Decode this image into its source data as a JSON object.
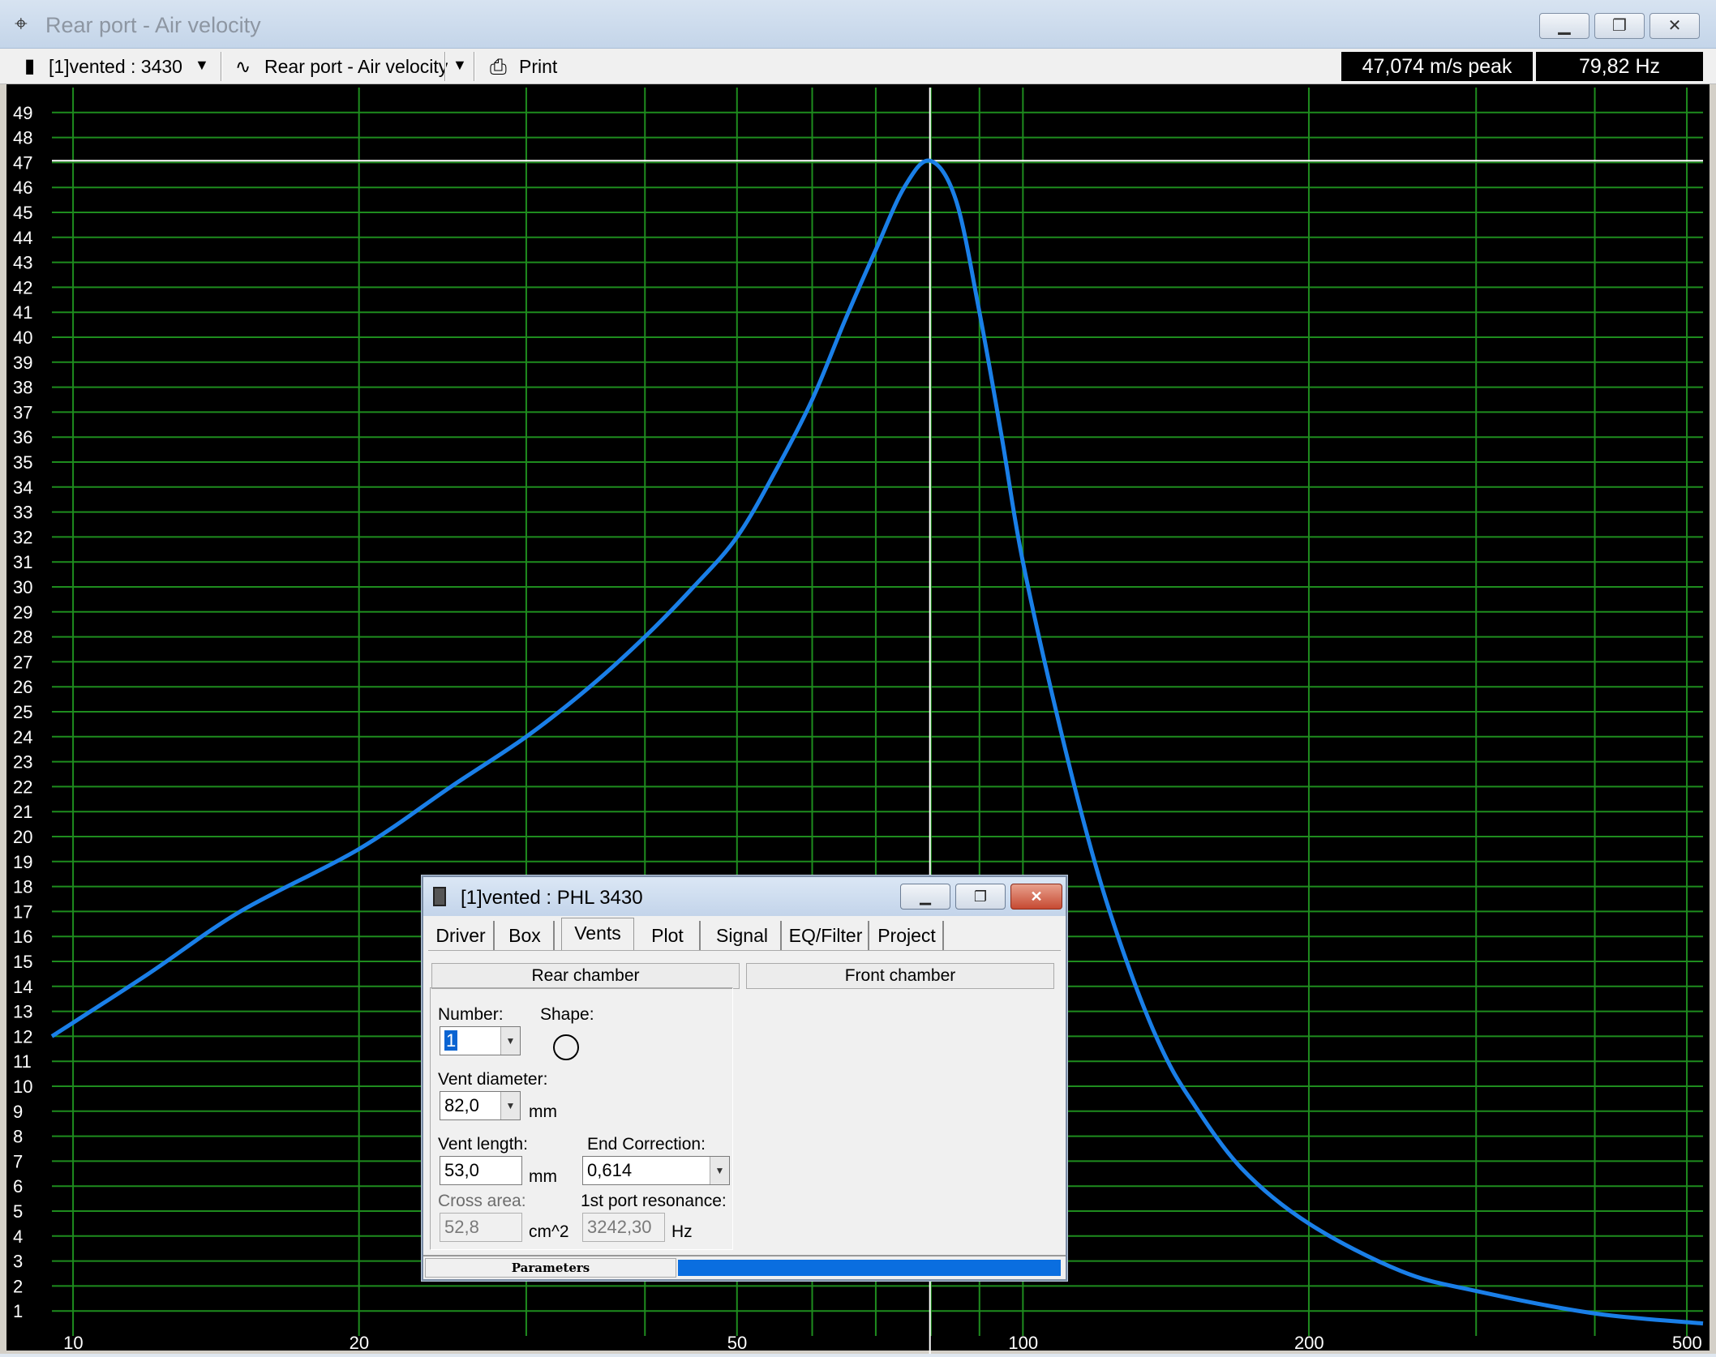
{
  "window": {
    "title": "Rear port - Air velocity",
    "buttons": [
      "minimize",
      "restore",
      "close"
    ]
  },
  "toolbar": {
    "project_select": "[1]vented : 3430",
    "graph_select": "Rear port - Air velocity",
    "print_label": "Print",
    "peak_readout": "47,074 m/s peak",
    "freq_readout": "79,82 Hz"
  },
  "chart_data": {
    "type": "line",
    "title": "Rear port - Air velocity",
    "xlabel": "",
    "ylabel": "",
    "x_scale": "log",
    "xlim": [
      9.5,
      520
    ],
    "ylim": [
      0,
      50
    ],
    "x_tick_labels": [
      "10",
      "20",
      "50",
      "100",
      "200",
      "500"
    ],
    "y_tick_labels": [
      "1",
      "2",
      "3",
      "4",
      "5",
      "6",
      "7",
      "8",
      "9",
      "10",
      "11",
      "12",
      "13",
      "14",
      "15",
      "16",
      "17",
      "18",
      "19",
      "20",
      "21",
      "22",
      "23",
      "24",
      "25",
      "26",
      "27",
      "28",
      "29",
      "30",
      "31",
      "32",
      "33",
      "34",
      "35",
      "36",
      "37",
      "38",
      "39",
      "40",
      "41",
      "42",
      "43",
      "44",
      "45",
      "46",
      "47",
      "48",
      "49"
    ],
    "grid": true,
    "cursor": {
      "x": 79.82,
      "y": 47.07
    },
    "line_color": "#1a7fe8",
    "grid_color": "#1e8c1e",
    "series": [
      {
        "x": [
          9.5,
          12,
          15,
          20,
          25,
          30,
          35,
          40,
          45,
          50,
          55,
          60,
          65,
          70,
          75,
          79.82,
          85,
          90,
          95,
          100,
          110,
          120,
          130,
          140,
          150,
          170,
          200,
          250,
          300,
          400,
          520
        ],
        "values": [
          12.0,
          14.5,
          17.0,
          19.5,
          22.0,
          24.0,
          26.0,
          28.0,
          30.0,
          32.0,
          34.7,
          37.5,
          40.7,
          43.5,
          46.0,
          47.07,
          45.5,
          41.0,
          36.0,
          31.0,
          24.0,
          18.5,
          14.5,
          11.5,
          9.5,
          6.7,
          4.5,
          2.6,
          1.8,
          0.9,
          0.5
        ]
      }
    ]
  },
  "dialog": {
    "title": "[1]vented : PHL 3430",
    "tabs": [
      "Driver",
      "Box",
      "Vents",
      "Plot",
      "Signal",
      "EQ/Filter",
      "Project"
    ],
    "active_tab": "Vents",
    "rear_chamber_label": "Rear chamber",
    "front_chamber_label": "Front chamber",
    "number_label": "Number:",
    "number_value": "1",
    "shape_label": "Shape:",
    "vent_diameter_label": "Vent diameter:",
    "vent_diameter_value": "82,0",
    "vent_diameter_unit": "mm",
    "vent_length_label": "Vent length:",
    "vent_length_value": "53,0",
    "vent_length_unit": "mm",
    "end_correction_label": "End Correction:",
    "end_correction_value": "0,614",
    "cross_area_label": "Cross area:",
    "cross_area_value": "52,8",
    "cross_area_unit": "cm^2",
    "port_resonance_label": "1st port resonance:",
    "port_resonance_value": "3242,30",
    "port_resonance_unit": "Hz",
    "status_label": "Parameters",
    "status_progress": 1.0
  }
}
